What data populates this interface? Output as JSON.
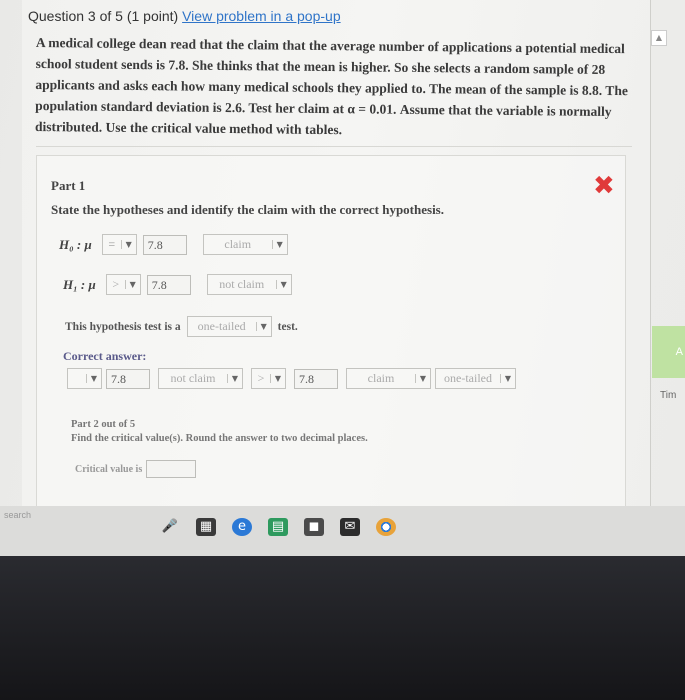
{
  "header": {
    "question_label": "Question 3 of 5 (1 point)",
    "popup_link": "View problem in a pop-up"
  },
  "problem": {
    "text": "A medical college dean read that the claim that the average number of applications a potential medical school student sends is 7.8. She thinks that the mean is higher. So she selects a random sample of 28 applicants and asks each how many medical schools they applied to. The mean of the sample is 8.8. The population standard deviation is 2.6. Test her claim at α = 0.01. Assume that the variable is normally distributed. Use the critical value method with tables."
  },
  "part1": {
    "title": "Part 1",
    "instruction": "State the hypotheses and identify the claim with the correct hypothesis.",
    "h0": {
      "symbol": "H₀ : μ",
      "operator": "=",
      "value": "7.8",
      "claim": "claim"
    },
    "h1": {
      "symbol": "H₁ : μ",
      "operator": ">",
      "value": "7.8",
      "claim": "not claim"
    },
    "test_prefix": "This hypothesis test is a",
    "test_type": "one-tailed",
    "test_suffix": "test.",
    "correct_label": "Correct answer:",
    "correct": {
      "h0_value": "7.8",
      "h0_claim": "not claim",
      "h1_operator": ">",
      "h1_value": "7.8",
      "h1_claim": "claim",
      "test_type": "one-tailed"
    }
  },
  "part2": {
    "title": "Part 2 out of 5",
    "instruction": "Find the critical value(s). Round the answer to two decimal places.",
    "critical_label": "Critical value is",
    "critical_value": ""
  },
  "side": {
    "scroll_up": "▲",
    "green_tab_text": "A",
    "time_label": "Tim"
  },
  "taskbar": {
    "search_text": "search"
  },
  "status": {
    "wrong_mark": "✖"
  }
}
